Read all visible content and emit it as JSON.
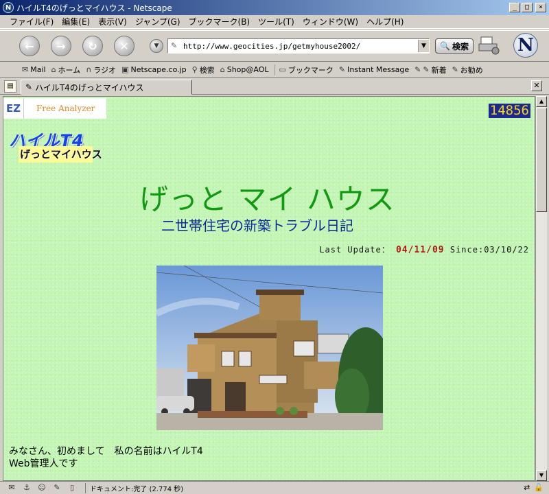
{
  "window": {
    "title": "ハイルT4のげっとマイハウス - Netscape"
  },
  "menu": [
    "ファイル(F)",
    "編集(E)",
    "表示(V)",
    "ジャンプ(G)",
    "ブックマーク(B)",
    "ツール(T)",
    "ウィンドウ(W)",
    "ヘルプ(H)"
  ],
  "nav": {
    "url": "http://www.geocities.jp/getmyhouse2002/",
    "search_label": "検索"
  },
  "personal_toolbar": {
    "items": [
      {
        "label": "Mail",
        "icon": "mail-icon"
      },
      {
        "label": "ホーム",
        "icon": "home-icon"
      },
      {
        "label": "ラジオ",
        "icon": "headphones-icon"
      },
      {
        "label": "Netscape.co.jp",
        "icon": "my-icon"
      },
      {
        "label": "検索",
        "icon": "search-icon"
      },
      {
        "label": "Shop@AOL",
        "icon": "shop-icon"
      },
      {
        "label": "ブックマーク",
        "icon": "folder-icon"
      },
      {
        "label": "Instant Message",
        "icon": "page-icon"
      },
      {
        "label": "新着",
        "icon": "page-icon"
      },
      {
        "label": "お勧め",
        "icon": "page-icon"
      }
    ]
  },
  "tab": {
    "label": "ハイルT4のげっとマイハウス"
  },
  "page": {
    "analyzer_ez": "EZ",
    "analyzer_label": "Free Analyzer",
    "counter": "14856",
    "logo_top": "ハイルT4",
    "logo_bottom": "げっとマイハウス",
    "title": "げっと マイ ハウス",
    "subtitle": "二世帯住宅の新築トラブル日記",
    "last_update_label": "Last Update：",
    "last_update_date": "04/11/09",
    "since_label": "Since:03/10/22",
    "intro_line1": "みなさん、初めまして　私の名前はハイルT4",
    "intro_line2": "Web管理人です"
  },
  "status": {
    "text": "ドキュメント:完了 (2.774 秒)"
  },
  "colors": {
    "page_bg": "#c3f5b4",
    "title_green": "#119911",
    "subtitle_blue": "#0b2a9a",
    "update_red": "#b01818",
    "counter_bg": "#1c2a8c",
    "counter_fg": "#f8d020"
  }
}
